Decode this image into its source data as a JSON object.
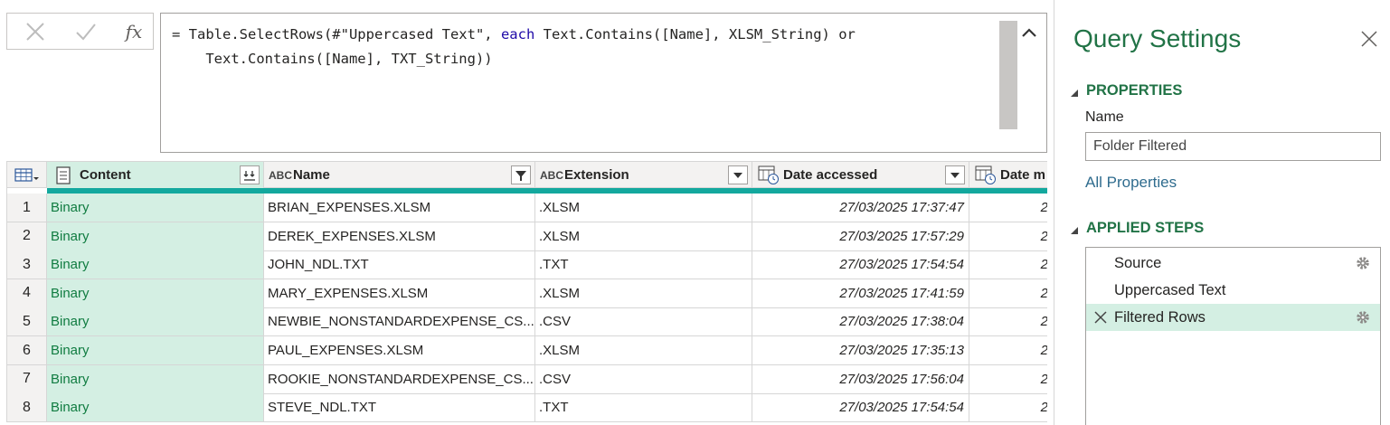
{
  "formula": {
    "fx_label": "fx",
    "line1_a": "= Table.SelectRows(#\"Uppercased Text\", ",
    "line1_kw": "each",
    "line1_b": " Text.Contains([Name], XLSM_String) or",
    "line2": "    Text.Contains([Name], TXT_String))"
  },
  "grid": {
    "columns": [
      {
        "label": "Content",
        "type_icon": "binary-icon",
        "button_icon": "expand-icon"
      },
      {
        "label": "Name",
        "type_icon": "text-type-icon",
        "button_icon": "filter-applied-icon"
      },
      {
        "label": "Extension",
        "type_icon": "text-type-icon",
        "button_icon": "dropdown-icon"
      },
      {
        "label": "Date accessed",
        "type_icon": "datetime-type-icon",
        "button_icon": "dropdown-icon"
      },
      {
        "label": "Date m",
        "type_icon": "datetime-type-icon"
      }
    ],
    "type_glyphs": {
      "text": "ABC"
    },
    "rows": [
      {
        "idx": "1",
        "content": "Binary",
        "name": "BRIAN_EXPENSES.XLSM",
        "ext": ".XLSM",
        "accessed": "27/03/2025 17:37:47",
        "modified": "2"
      },
      {
        "idx": "2",
        "content": "Binary",
        "name": "DEREK_EXPENSES.XLSM",
        "ext": ".XLSM",
        "accessed": "27/03/2025 17:57:29",
        "modified": "2"
      },
      {
        "idx": "3",
        "content": "Binary",
        "name": "JOHN_NDL.TXT",
        "ext": ".TXT",
        "accessed": "27/03/2025 17:54:54",
        "modified": "2"
      },
      {
        "idx": "4",
        "content": "Binary",
        "name": "MARY_EXPENSES.XLSM",
        "ext": ".XLSM",
        "accessed": "27/03/2025 17:41:59",
        "modified": "2"
      },
      {
        "idx": "5",
        "content": "Binary",
        "name": "NEWBIE_NONSTANDARDEXPENSE_CS...",
        "ext": ".CSV",
        "accessed": "27/03/2025 17:38:04",
        "modified": "2"
      },
      {
        "idx": "6",
        "content": "Binary",
        "name": "PAUL_EXPENSES.XLSM",
        "ext": ".XLSM",
        "accessed": "27/03/2025 17:35:13",
        "modified": "2"
      },
      {
        "idx": "7",
        "content": "Binary",
        "name": "ROOKIE_NONSTANDARDEXPENSE_CS...",
        "ext": ".CSV",
        "accessed": "27/03/2025 17:56:04",
        "modified": "2"
      },
      {
        "idx": "8",
        "content": "Binary",
        "name": "STEVE_NDL.TXT",
        "ext": ".TXT",
        "accessed": "27/03/2025 17:54:54",
        "modified": "2"
      }
    ]
  },
  "settings": {
    "title": "Query Settings",
    "properties_header": "PROPERTIES",
    "name_label": "Name",
    "name_value": "Folder Filtered",
    "all_properties": "All Properties",
    "steps_header": "APPLIED STEPS",
    "steps": [
      {
        "label": "Source",
        "has_gear": true,
        "active": false
      },
      {
        "label": "Uppercased Text",
        "has_gear": false,
        "active": false
      },
      {
        "label": "Filtered Rows",
        "has_gear": true,
        "active": true
      }
    ]
  },
  "colors": {
    "accent_green": "#217346",
    "selected_bg": "#d4efe3",
    "quality_bar": "#13a89e",
    "link_blue": "#2f6c8e",
    "keyword_blue": "#1f0aa8"
  }
}
